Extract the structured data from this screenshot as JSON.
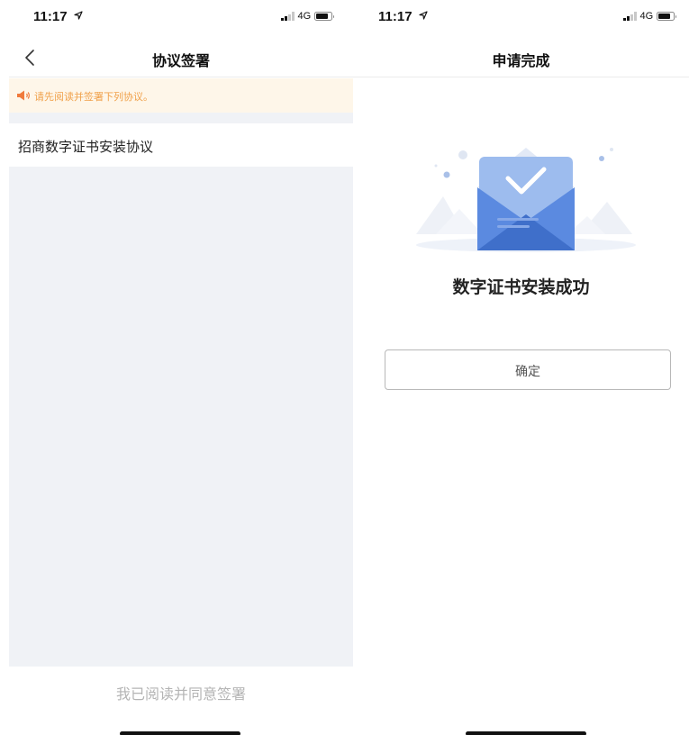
{
  "left_screen": {
    "status": {
      "time": "11:17",
      "network": "4G"
    },
    "nav": {
      "title": "协议签署"
    },
    "notice": {
      "text": "请先阅读并签署下列协议。"
    },
    "agreements": [
      {
        "label": "招商数字证书安装协议"
      }
    ],
    "footer": {
      "agree_label": "我已阅读并同意签署"
    }
  },
  "right_screen": {
    "status": {
      "time": "11:17",
      "network": "4G"
    },
    "nav": {
      "title": "申请完成"
    },
    "result": {
      "message": "数字证书安装成功"
    },
    "confirm_label": "确定"
  },
  "colors": {
    "notice_background": "#fef6e9",
    "notice_accent": "#f07a3c",
    "page_gray": "#f0f2f6",
    "envelope_blue": "#5b8ae0"
  }
}
